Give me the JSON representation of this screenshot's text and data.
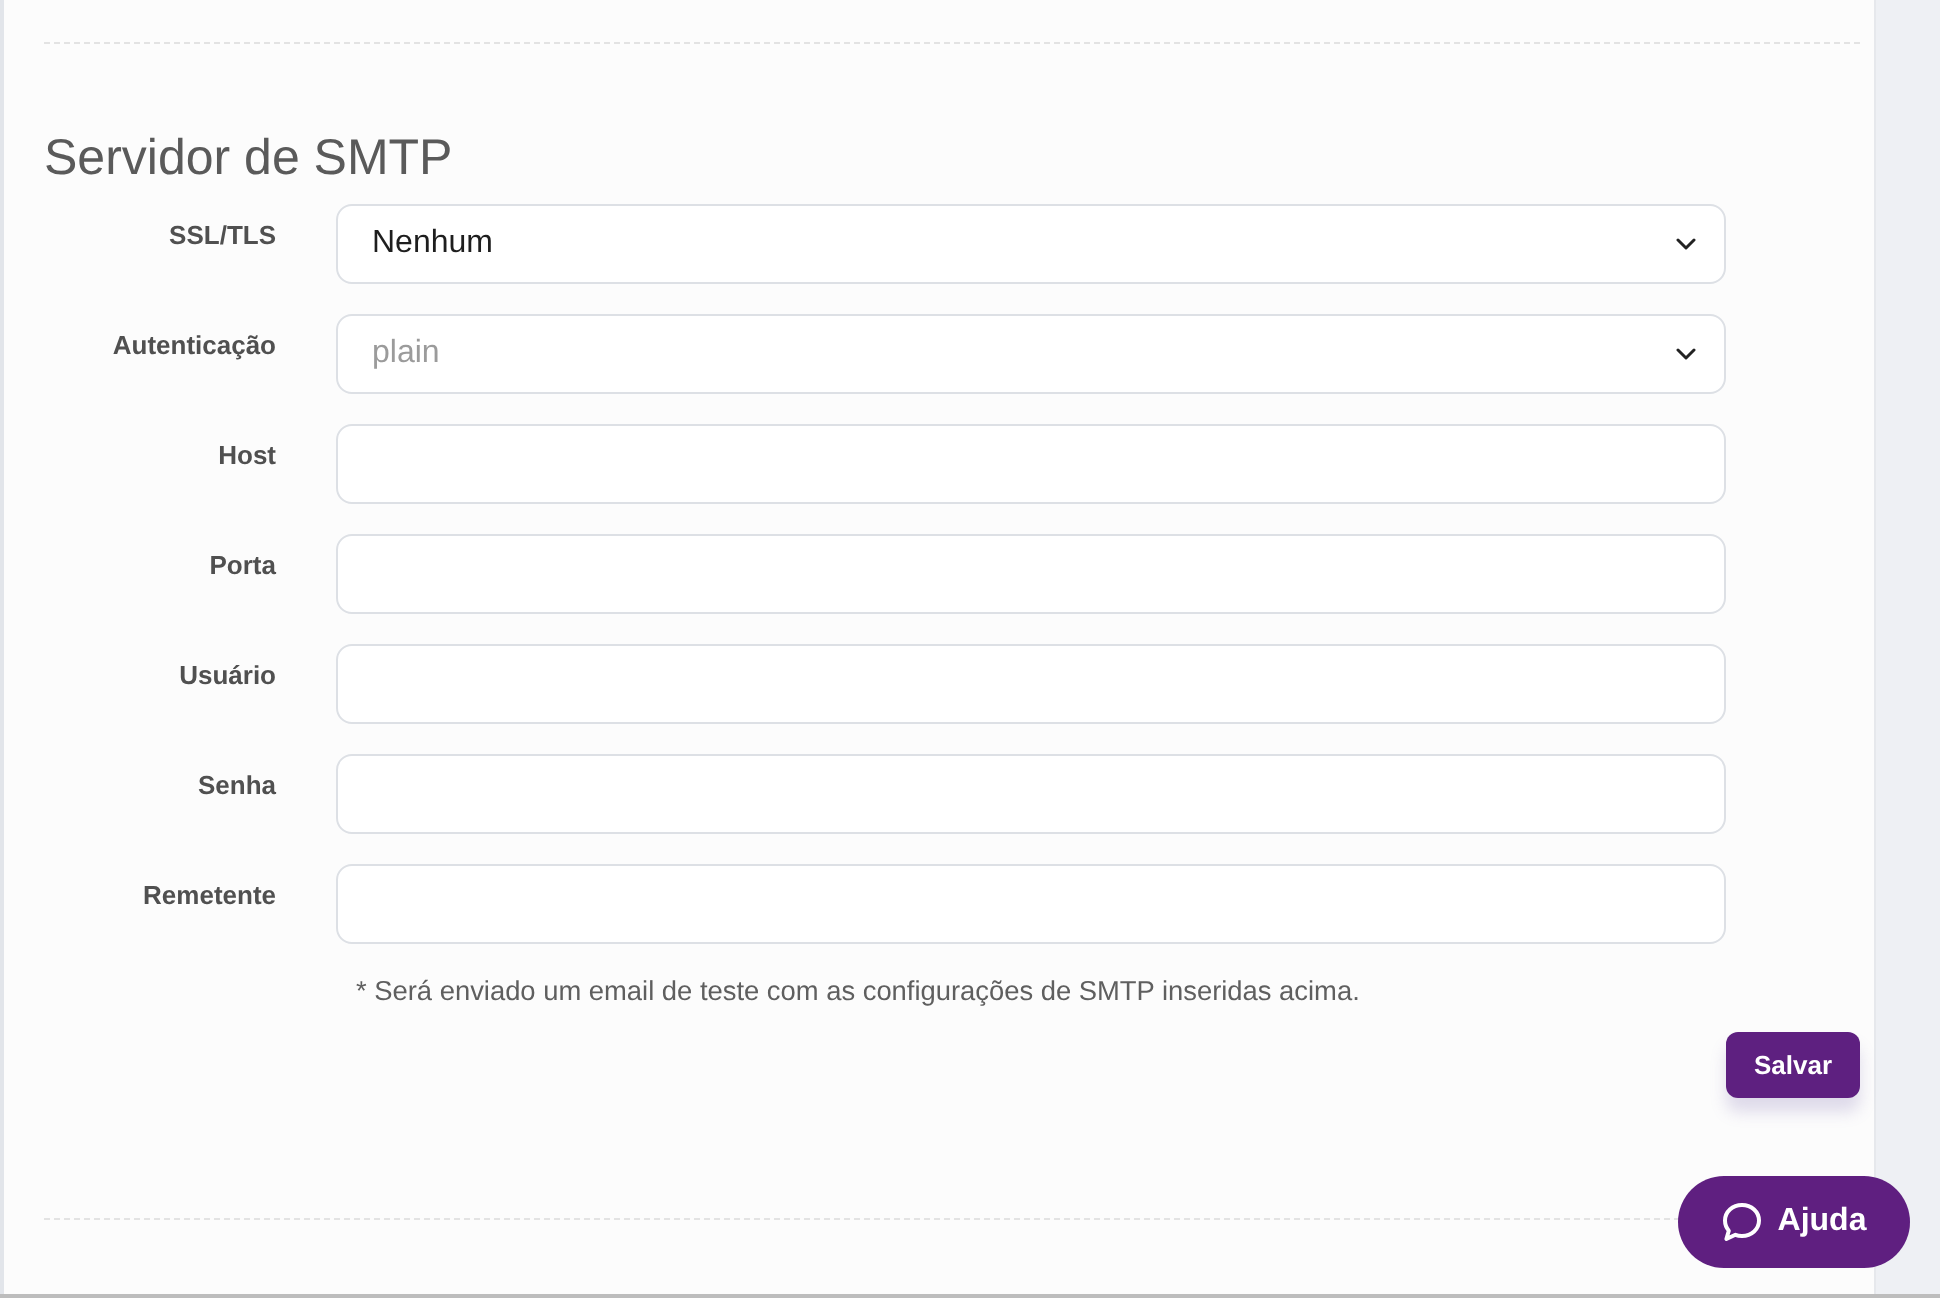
{
  "section": {
    "title": "Servidor de SMTP"
  },
  "fields": [
    {
      "label": "SSL/TLS",
      "kind": "select",
      "value": "Nenhum"
    },
    {
      "label": "Autenticação",
      "kind": "select",
      "placeholder": "plain"
    },
    {
      "label": "Host",
      "kind": "text"
    },
    {
      "label": "Porta",
      "kind": "text"
    },
    {
      "label": "Usuário",
      "kind": "text"
    },
    {
      "label": "Senha",
      "kind": "text"
    },
    {
      "label": "Remetente",
      "kind": "text"
    }
  ],
  "note": "* Será enviado um email de teste com as configurações de SMTP inseridas acima.",
  "save_button": "Salvar",
  "help_button": "Ajuda"
}
